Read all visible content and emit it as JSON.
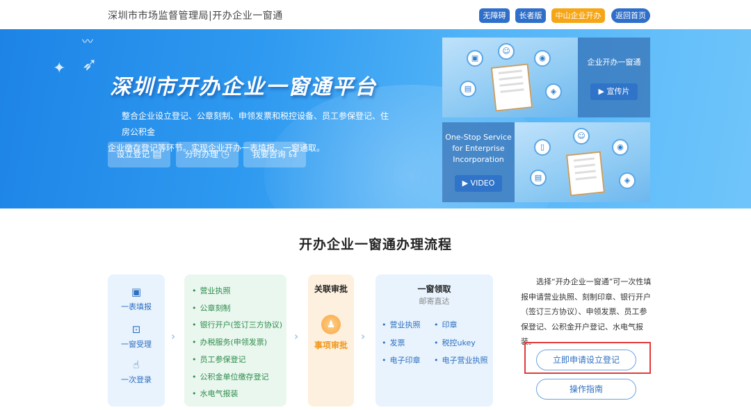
{
  "header": {
    "site_title": "深圳市市场监督管理局|开办企业一窗通",
    "buttons": {
      "accessible": "无障碍",
      "elder": "长者版",
      "zhongshan": "中山企业开办",
      "home": "返回首页"
    }
  },
  "banner": {
    "title": "深圳市开办企业一窗通平台",
    "desc_lines": [
      "整合企业设立登记、公章刻制、申领发票和税控设备、员工参保登记、住房公积金",
      "企业缴存登记等环节。实现企业开办一表填报、一窗通取。"
    ],
    "buttons": {
      "setup": "设立登记",
      "period": "分时办理",
      "consult": "我要咨询"
    },
    "promo_cn": {
      "caption": "企业开办一窗通",
      "button": "宣传片"
    },
    "promo_en": {
      "caption_lines": [
        "One-Stop Service",
        "for Enterprise",
        "Incorporation"
      ],
      "button": "VIDEO"
    }
  },
  "process": {
    "title": "开办企业一窗通办理流程",
    "step1": [
      "一表填报",
      "一窗受理",
      "一次登录"
    ],
    "step2": [
      "营业执照",
      "公章刻制",
      "银行开户(签订三方协议)",
      "办税服务(申领发票)",
      "员工参保登记",
      "公积金单位缴存登记",
      "水电气报装"
    ],
    "step3": {
      "title": "关联审批",
      "label": "事项审批"
    },
    "step4": {
      "title": "一窗领取",
      "subtitle": "邮寄直达",
      "items_left": [
        "营业执照",
        "发票",
        "电子印章"
      ],
      "items_right": [
        "印章",
        "税控ukey",
        "电子营业执照"
      ]
    },
    "description_lines": [
      "选择“开办企业一窗通”可一次性填",
      "报申请营业执照、刻制印章、银行开户",
      "（签订三方协议）、申领发票、员工参",
      "保登记、公积金开户登记、水电气报",
      "装。"
    ],
    "apply_button": "立即申请设立登记",
    "guide_button": "操作指南"
  }
}
